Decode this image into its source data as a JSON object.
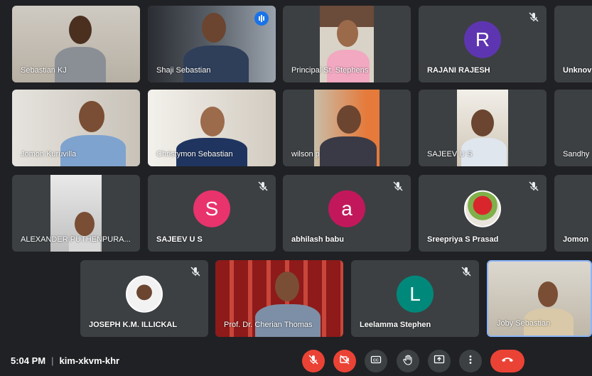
{
  "participants": [
    {
      "name": "Sebastian KJ",
      "type": "video"
    },
    {
      "name": "Shaji Sebastian",
      "type": "video",
      "speaking": true
    },
    {
      "name": "Principal St. Stephens",
      "type": "video"
    },
    {
      "name": "RAJANI RAJESH",
      "type": "avatar",
      "initial": "R",
      "color": "#5e35b1",
      "muted": true
    },
    {
      "name": "Unknov",
      "type": "blank"
    },
    {
      "name": "Jomon Kuruvilla",
      "type": "video"
    },
    {
      "name": "Christymon Sebastian",
      "type": "video"
    },
    {
      "name": "wilson p",
      "type": "video"
    },
    {
      "name": "SAJEEV U S",
      "type": "video"
    },
    {
      "name": "Sandhy",
      "type": "blank"
    },
    {
      "name": "ALEXANDER PUTHENPURA...",
      "type": "video"
    },
    {
      "name": "SAJEEV U S",
      "type": "avatar",
      "initial": "S",
      "color": "#e8336d",
      "muted": true
    },
    {
      "name": "abhilash babu",
      "type": "avatar",
      "initial": "a",
      "color": "#c2185b",
      "muted": true
    },
    {
      "name": "Sreepriya S Prasad",
      "type": "photo",
      "muted": true
    },
    {
      "name": "Jomon",
      "type": "blank"
    },
    {
      "name": "JOSEPH K.M. ILLICKAL",
      "type": "photo",
      "muted": true
    },
    {
      "name": "Prof. Dr. Cherian Thomas",
      "type": "video"
    },
    {
      "name": "Leelamma Stephen",
      "type": "avatar",
      "initial": "L",
      "color": "#00897b",
      "muted": true
    },
    {
      "name": "Joby Sebastian",
      "type": "video",
      "active": true
    }
  ],
  "bottom_bar": {
    "time": "5:04 PM",
    "separator": "|",
    "meeting_code": "kim-xkvm-khr"
  },
  "controls": [
    {
      "icon": "mic-off-icon",
      "state": "off"
    },
    {
      "icon": "camera-off-icon",
      "state": "off"
    },
    {
      "icon": "captions-icon"
    },
    {
      "icon": "raise-hand-icon"
    },
    {
      "icon": "present-screen-icon"
    },
    {
      "icon": "more-options-icon"
    },
    {
      "icon": "hang-up-icon"
    }
  ]
}
